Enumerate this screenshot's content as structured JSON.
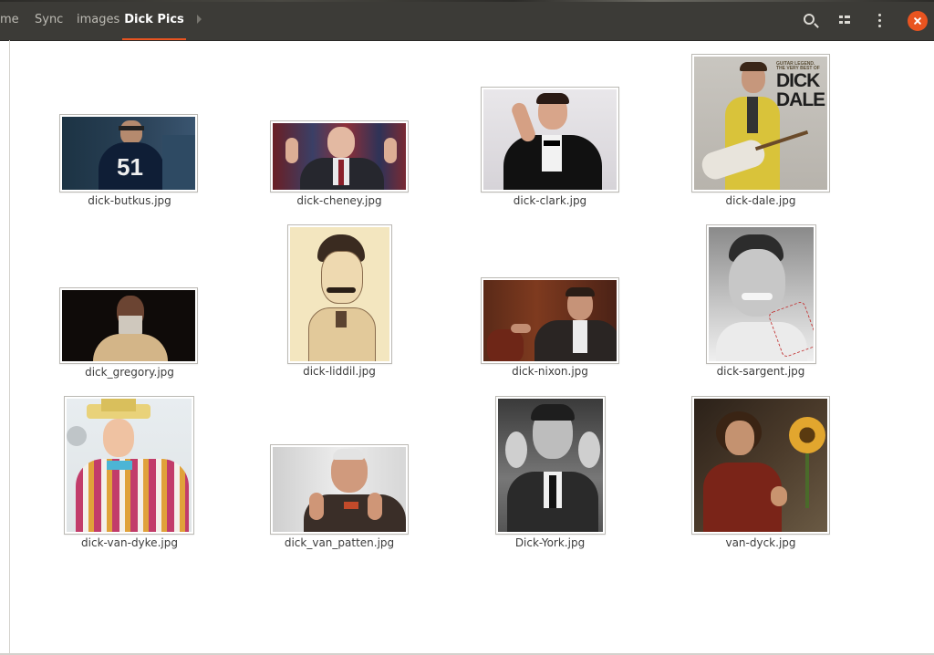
{
  "window": {
    "breadcrumbs": [
      {
        "label": "me"
      },
      {
        "label": "Sync"
      },
      {
        "label": "images"
      },
      {
        "label": "Dick Pics",
        "active": true
      }
    ],
    "accent_color": "#e95420",
    "header_icons": [
      "search-icon",
      "view-toggle-icon",
      "menu-icon",
      "close-icon"
    ]
  },
  "files": [
    {
      "name": "dick-butkus.jpg"
    },
    {
      "name": "dick-cheney.jpg"
    },
    {
      "name": "dick-clark.jpg"
    },
    {
      "name": "dick-dale.jpg",
      "thumbnail_text": "GUITAR LEGEND. THE VERY BEST OF DICK DALE"
    },
    {
      "name": "dick_gregory.jpg"
    },
    {
      "name": "dick-liddil.jpg"
    },
    {
      "name": "dick-nixon.jpg"
    },
    {
      "name": "dick-sargent.jpg"
    },
    {
      "name": "dick-van-dyke.jpg"
    },
    {
      "name": "dick_van_patten.jpg"
    },
    {
      "name": "Dick-York.jpg"
    },
    {
      "name": "van-dyck.jpg"
    }
  ]
}
